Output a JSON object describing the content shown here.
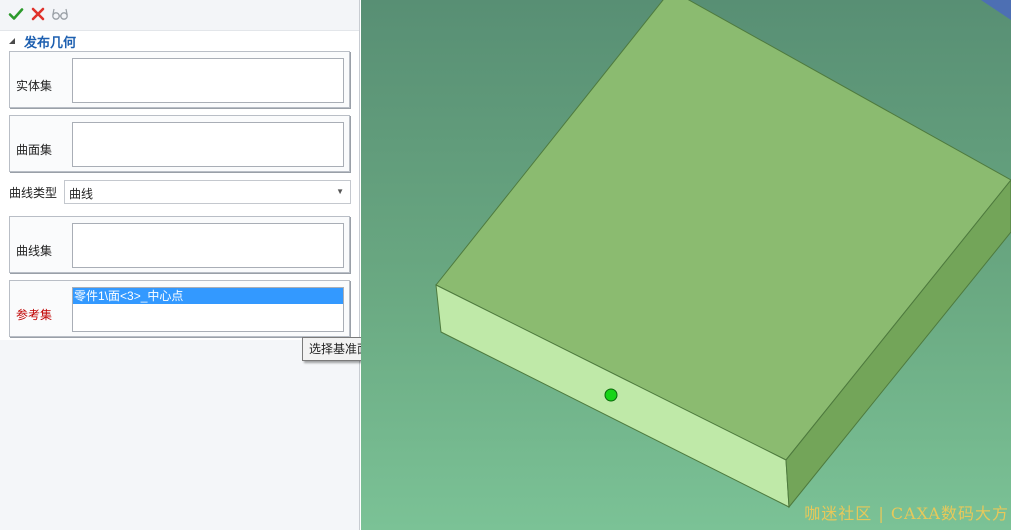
{
  "toolbar": {
    "ok_icon": "check-icon",
    "cancel_icon": "close-icon",
    "preview_icon": "glasses-preview-icon"
  },
  "panel": {
    "title": "发布几何",
    "solid_set_label": "实体集",
    "surface_set_label": "曲面集",
    "curve_type_label": "曲线类型",
    "curve_type_value": "曲线",
    "curve_set_label": "曲线集",
    "reference_set_label": "参考集",
    "reference_items": [
      "零件1\\面<3>_中心点"
    ]
  },
  "tooltip": {
    "text": "选择基准面/基准轴/点"
  },
  "viewport": {
    "watermark": "咖迷社区 | CAXA数码大方"
  },
  "colors": {
    "accent": "#1d5fb0",
    "required_label": "#c00000",
    "selection": "#3399ff",
    "part_top": "#8bbb70",
    "part_front": "#bfe9a8",
    "part_side": "#73a559",
    "center_point": "#18d418"
  }
}
